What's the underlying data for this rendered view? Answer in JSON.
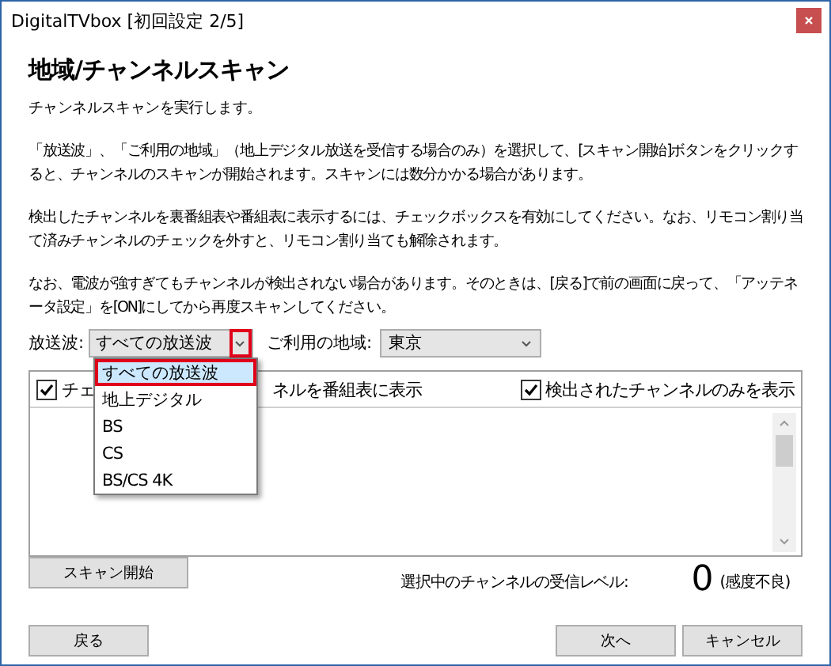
{
  "window": {
    "title": "DigitalTVbox [初回設定 2/5]"
  },
  "heading": "地域/チャンネルスキャン",
  "intro": "チャンネルスキャンを実行します。",
  "paragraphs": [
    "「放送波」、「ご利用の地域」（地上デジタル放送を受信する場合のみ）を選択して、[スキャン開始]ボタンをクリックすると、チャンネルのスキャンが開始されます。スキャンには数分かかる場合があります。",
    "検出したチャンネルを裏番組表や番組表に表示するには、チェックボックスを有効にしてください。なお、リモコン割り当て済みチャンネルのチェックを外すと、リモコン割り当ても解除されます。",
    "なお、電波が強すぎてもチャンネルが検出されない場合があります。そのときは、[戻る]で前の画面に戻って、「アッテネータ設定」を[ON]にしてから再度スキャンしてください。"
  ],
  "broadcast": {
    "label": "放送波:",
    "value": "すべての放送波",
    "arrow_highlighted": true,
    "expanded": true,
    "options": [
      {
        "label": "すべての放送波",
        "selected": true,
        "highlighted": true
      },
      {
        "label": "地上デジタル",
        "selected": false,
        "highlighted": false
      },
      {
        "label": "BS",
        "selected": false,
        "highlighted": false
      },
      {
        "label": "CS",
        "selected": false,
        "highlighted": false
      },
      {
        "label": "BS/CS 4K",
        "selected": false,
        "highlighted": false
      }
    ]
  },
  "region": {
    "label": "ご利用の地域:",
    "value": "東京"
  },
  "channel_list": {
    "show_in_guide": {
      "label_start": "チェ",
      "label_end": "ネルを番組表に表示",
      "checked": true
    },
    "detected_only": {
      "label": "検出されたチャンネルのみを表示",
      "checked": true
    }
  },
  "scan_button": "スキャン開始",
  "reception": {
    "label": "選択中のチャンネルの受信レベル:",
    "value": "0",
    "status": "(感度不良)"
  },
  "buttons": {
    "back": "戻る",
    "next": "次へ",
    "cancel": "キャンセル"
  }
}
